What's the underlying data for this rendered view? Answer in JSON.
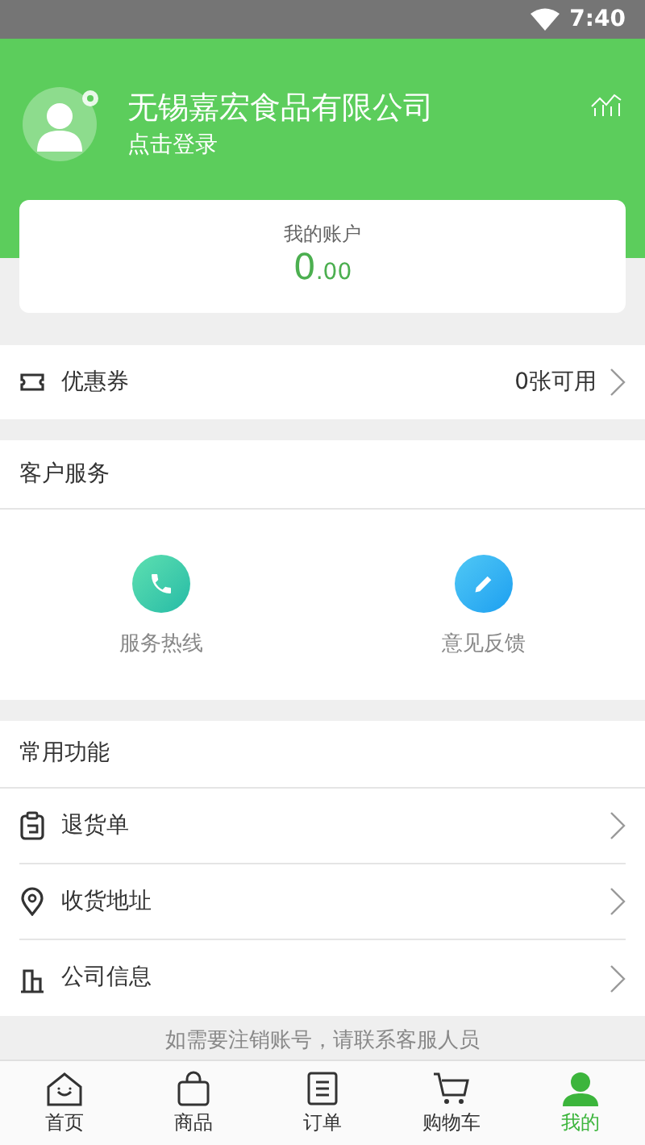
{
  "status_bar": {
    "time": "7:40"
  },
  "header": {
    "company": "无锡嘉宏食品有限公司",
    "login": "点击登录"
  },
  "account": {
    "title": "我的账户",
    "amount_int": "0",
    "amount_dec": ".00"
  },
  "coupon": {
    "label": "优惠券",
    "value": "0张可用"
  },
  "service": {
    "title": "客户服务",
    "items": [
      {
        "label": "服务热线",
        "kind": "phone"
      },
      {
        "label": "意见反馈",
        "kind": "edit"
      }
    ]
  },
  "functions": {
    "title": "常用功能",
    "items": [
      {
        "label": "退货单",
        "kind": "return"
      },
      {
        "label": "收货地址",
        "kind": "location"
      },
      {
        "label": "公司信息",
        "kind": "company"
      }
    ]
  },
  "notice": "如需要注销账号，请联系客服人员",
  "tabs": [
    {
      "label": "首页",
      "kind": "home",
      "selected": false
    },
    {
      "label": "商品",
      "kind": "bag",
      "selected": false
    },
    {
      "label": "订单",
      "kind": "list",
      "selected": false
    },
    {
      "label": "购物车",
      "kind": "cart",
      "selected": false
    },
    {
      "label": "我的",
      "kind": "user",
      "selected": true
    }
  ]
}
